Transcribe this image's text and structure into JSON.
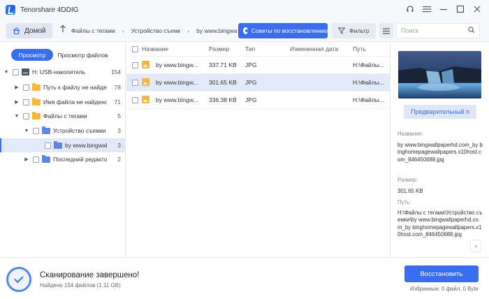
{
  "app": {
    "title": "Tenorshare 4DDIG"
  },
  "window_controls": [
    "headset-icon",
    "menu-icon",
    "minimize-icon",
    "maximize-icon",
    "close-icon"
  ],
  "toolbar": {
    "home_label": "Домой",
    "breadcrumb": [
      "Файлы с тегами",
      "Устройство съемк",
      "by www.bingwa"
    ],
    "tips_label": "Советы по восстановлению",
    "filter_label": "Фильтр",
    "search_placeholder": "Поиск"
  },
  "view_tabs": {
    "tree": "Просмотр",
    "file": "Просмотр файлов"
  },
  "tree": [
    {
      "label": "H: USB-накопитель",
      "count": "154"
    },
    {
      "label": "Путь к файлу не найден",
      "count": "78"
    },
    {
      "label": "Имя файла не найдено",
      "count": "71"
    },
    {
      "label": "Файлы с тегами",
      "count": "5"
    },
    {
      "label": "Устройство съемки",
      "count": "3"
    },
    {
      "label": "by www.bingwall...",
      "count": "3"
    },
    {
      "label": "Последний редактор",
      "count": "2"
    }
  ],
  "table": {
    "headers": {
      "name": "Название",
      "size": "Размер",
      "type": "Тип",
      "date": "Измененная дата",
      "path": "Путь"
    },
    "rows": [
      {
        "name": "by www.bingw...",
        "size": "337.71 KB",
        "type": "JPG",
        "date": "",
        "path": "H:\\Файлы..."
      },
      {
        "name": "by www.bingw...",
        "size": "301.65 KB",
        "type": "JPG",
        "date": "",
        "path": "H:\\Файлы..."
      },
      {
        "name": "by www.bingw...",
        "size": "336.38 KB",
        "type": "JPG",
        "date": "",
        "path": "H:\\Файлы..."
      }
    ]
  },
  "preview": {
    "button_label": "Предварительный п",
    "name_label": "Название:",
    "name_value": "by www.bingwallpaperhd.com_by binghomepagewallpapers.x10host.com_846450688.jpg",
    "size_label": "Размер:",
    "size_value": "301.65 KB",
    "path_label": "Путь:",
    "path_value": "H:\\Файлы с тегами\\Устройство съемки\\by www.bingwallpaperhd.com_by binghomepagewallpapers.x10host.com_846450688.jpg"
  },
  "status": {
    "title": "Сканирование завершено!",
    "subtitle": "Найдено 154 файлов (1.11 GB)",
    "recover_label": "Восстановить",
    "selected_info": "Избранные: 0 файл, 0 Byte"
  },
  "colors": {
    "accent": "#3a6df0",
    "selection": "#e2e9f9",
    "folder_orange": "#f6b73c",
    "folder_blue": "#5b86e5"
  }
}
